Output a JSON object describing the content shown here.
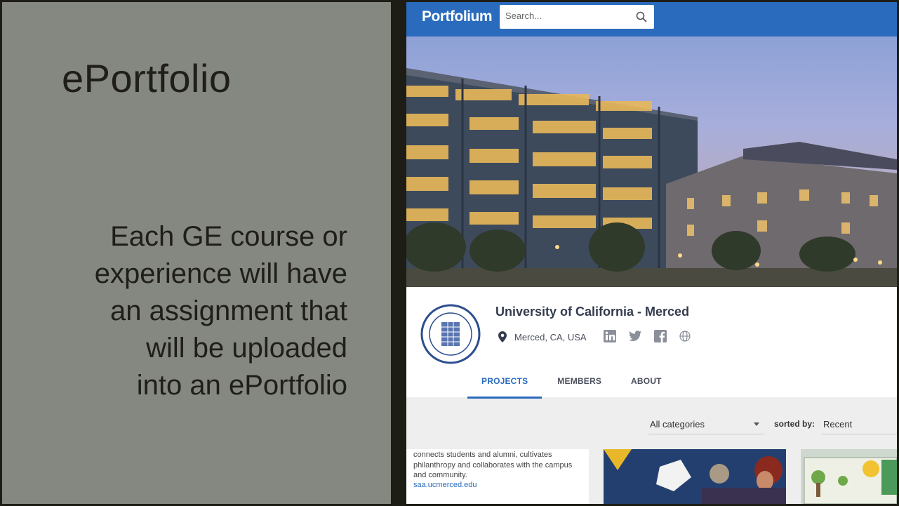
{
  "slide": {
    "title": "ePortfolio",
    "body_lines": [
      "Each GE course or",
      "experience will have",
      "an assignment that",
      "will be uploaded",
      "into an ePortfolio"
    ]
  },
  "portfolium": {
    "logo": "Portfolium",
    "search_placeholder": "Search...",
    "profile": {
      "name": "University of California - Merced",
      "location": "Merced, CA, USA"
    },
    "tabs": [
      {
        "label": "PROJECTS",
        "active": true
      },
      {
        "label": "MEMBERS",
        "active": false
      },
      {
        "label": "ABOUT",
        "active": false
      }
    ],
    "filters": {
      "category": "All categories",
      "sorted_label": "sorted by:",
      "sort_value": "Recent"
    },
    "cards": {
      "first_description": "connects students and alumni, cultivates philanthropy and collaborates with the campus and community.",
      "first_link": "saa.ucmerced.edu"
    },
    "colors": {
      "brand": "#2a6bbd",
      "slide_bg": "#858781",
      "frame": "#1e1d15"
    },
    "icons": [
      "search-icon",
      "location-pin-icon",
      "linkedin-icon",
      "twitter-icon",
      "facebook-icon",
      "globe-icon",
      "chevron-down-icon"
    ]
  }
}
